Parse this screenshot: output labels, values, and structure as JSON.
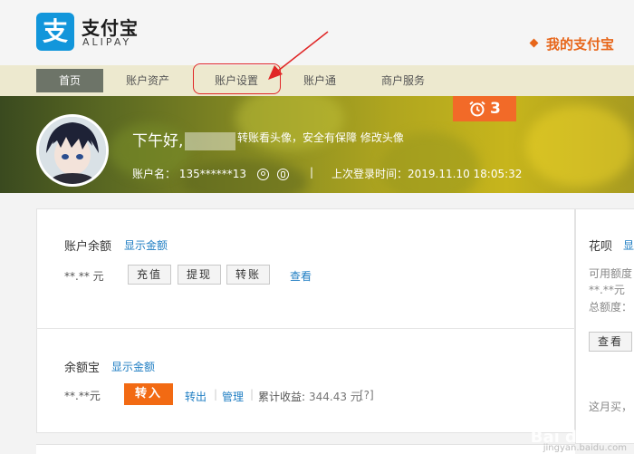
{
  "logo": {
    "cn": "支付宝",
    "en": "ALIPAY",
    "mark": "支"
  },
  "header": {
    "my_alipay": "我的支付宝"
  },
  "nav": {
    "items": [
      {
        "label": "首页"
      },
      {
        "label": "账户资产"
      },
      {
        "label": "账户设置"
      },
      {
        "label": "账户通"
      },
      {
        "label": "商户服务"
      }
    ]
  },
  "banner": {
    "greeting": "下午好,",
    "greeting_links": "转账看头像，安全有保障 修改头像",
    "account_label": "账户名：",
    "account_value": "135******13",
    "separator": "|",
    "last_login_label": "上次登录时间：",
    "last_login_value": "2019.11.10 18:05:32",
    "alarm_count": "3"
  },
  "balance": {
    "title": "账户余额",
    "show": "显示金额",
    "amount": "**.** 元",
    "buttons": [
      "充值",
      "提现",
      "转账"
    ],
    "view": "查看"
  },
  "yuebao": {
    "title": "余额宝",
    "show": "显示金额",
    "amount": "**.**元",
    "transfer_in": "转入",
    "transfer_out": "转出",
    "divider": "|",
    "manage": "管理",
    "earnings_label": "累计收益:",
    "earnings_value": "344.43 元",
    "help": "[?]"
  },
  "huabei": {
    "title": "花呗",
    "show_partial": "显",
    "available_label": "可用额度",
    "available_value": "**.**元",
    "total_label": "总额度：",
    "view": "查看",
    "monthly": "这月买，"
  },
  "watermark": {
    "brand": "Bai du 经验",
    "sub": "jingyan.baidu.com"
  },
  "colors": {
    "brand_blue": "#1296db",
    "accent_orange": "#f26a13",
    "nav_active": "#6d7468",
    "link_blue": "#1f7ec3",
    "annotation_red": "#e02626"
  }
}
